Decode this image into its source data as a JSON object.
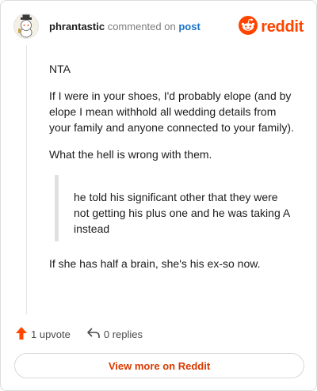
{
  "header": {
    "username": "phrantastic",
    "action": "commented on",
    "post_link": "post",
    "brand": "reddit"
  },
  "comment": {
    "paragraphs": [
      "NTA",
      "If I were in your shoes, I'd probably elope (and by elope I mean withhold all wedding details from your family and anyone connected to your family).",
      "What the hell is wrong with them."
    ],
    "quote": "he told his significant other that they were not getting his plus one and he was taking A instead",
    "closing": "If she has half a brain, she's his ex-so now."
  },
  "footer": {
    "upvotes": "1 upvote",
    "replies": "0 replies",
    "view_more": "View more on Reddit"
  },
  "colors": {
    "accent": "#ff4500",
    "link": "#1a73c8",
    "button_text": "#d93a00"
  },
  "icons": [
    "avatar",
    "reddit-logo-icon",
    "upvote-icon",
    "reply-icon"
  ]
}
